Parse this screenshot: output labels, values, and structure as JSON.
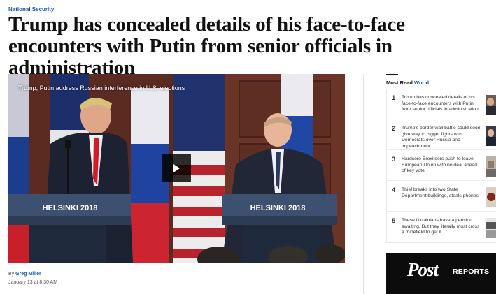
{
  "article": {
    "kicker": "National Security",
    "headline": "Trump has concealed details of his face-to-face encounters with Putin from senior officials in administration",
    "byline_prefix": "By",
    "author": "Greg Miller",
    "date": "January 13 at 8:30 AM"
  },
  "video": {
    "caption": "Trump, Putin address Russian interference in U.S. elections",
    "podium_left": "HELSINKI 2018",
    "podium_right": "HELSINKI 2018",
    "play_icon": "play-icon"
  },
  "most_read": {
    "title": "Most Read",
    "section": "World",
    "items": [
      {
        "num": "1",
        "text": "Trump has concealed details of his face-to-face encounters with Putin from senior officials in administration"
      },
      {
        "num": "2",
        "text": "Trump's border wall battle could soon give way to bigger fights with Democrats over Russia and impeachment"
      },
      {
        "num": "3",
        "text": "Hardcore Brexiteers push to leave European Union with no deal ahead of key vote"
      },
      {
        "num": "4",
        "text": "Thief breaks into two State Department buildings, steals phones"
      },
      {
        "num": "5",
        "text": "These Ukrainians have a pension awaiting. But they literally must cross a minefield to get it."
      }
    ]
  },
  "ad": {
    "brand": "Post",
    "product": "REPORTS"
  },
  "colors": {
    "link_blue": "#1955a5",
    "text": "#111111"
  }
}
